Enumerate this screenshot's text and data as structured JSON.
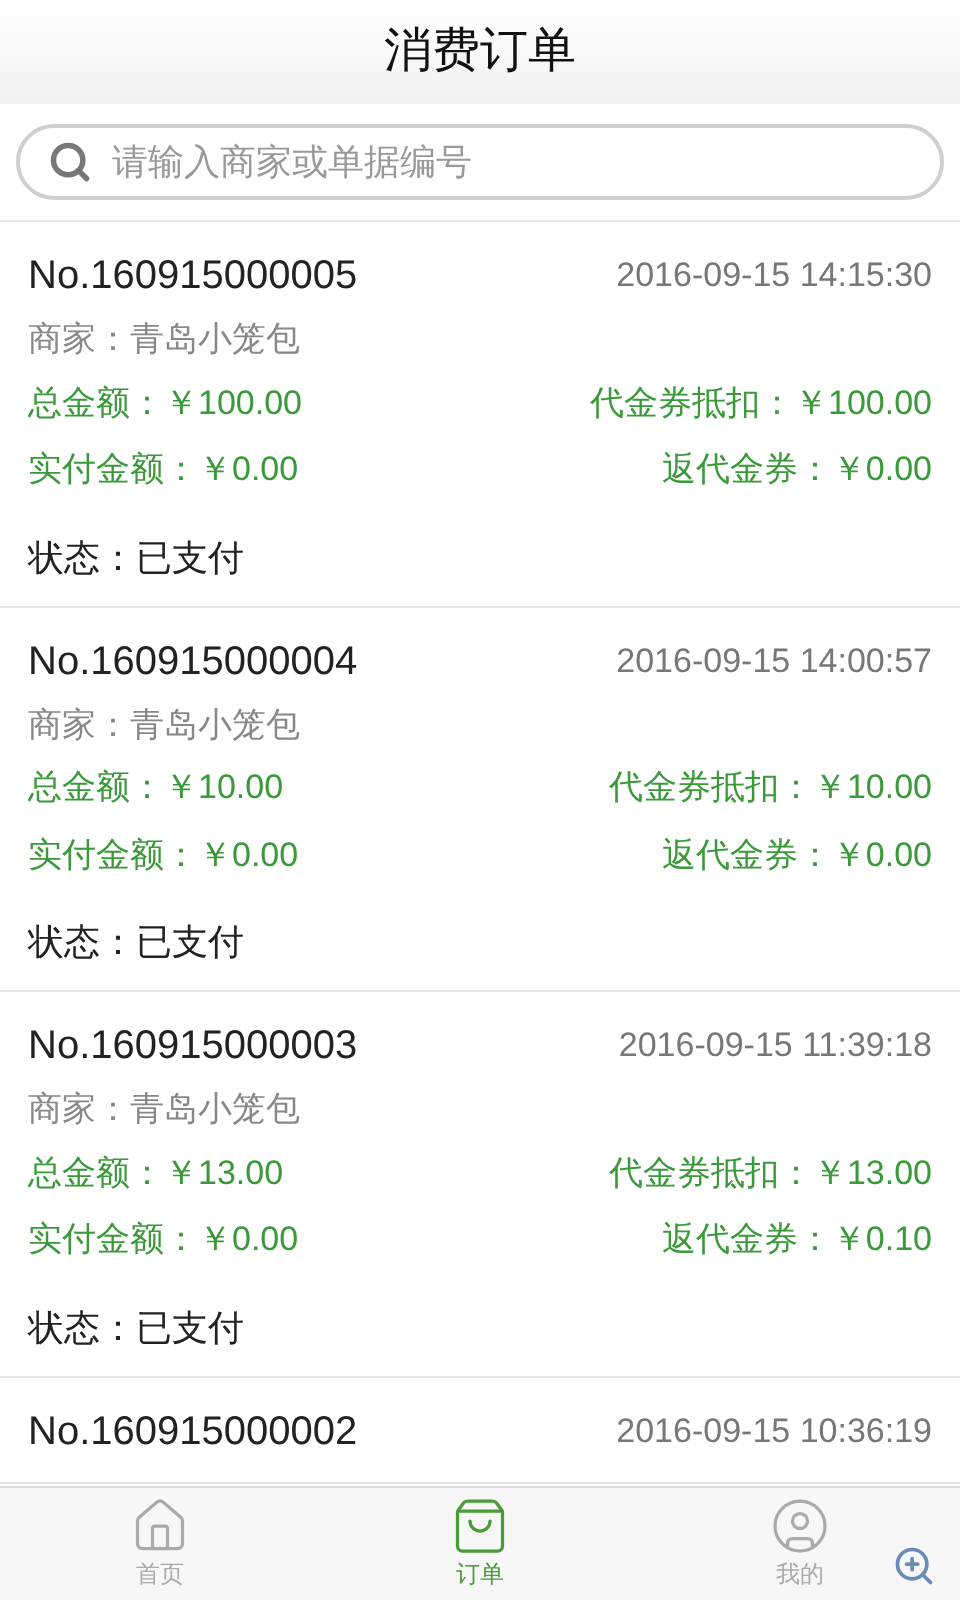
{
  "header": {
    "title": "消费订单"
  },
  "search": {
    "placeholder": "请输入商家或单据编号"
  },
  "orders": [
    {
      "number": "No.160915000005",
      "time": "2016-09-15 14:15:30",
      "merchant": "商家：青岛小笼包",
      "total": "总金额：￥100.00",
      "voucher_deduct": "代金券抵扣：￥100.00",
      "paid": "实付金额：￥0.00",
      "voucher_return": "返代金券：￥0.00",
      "status": "状态：已支付"
    },
    {
      "number": "No.160915000004",
      "time": "2016-09-15 14:00:57",
      "merchant": "商家：青岛小笼包",
      "total": "总金额：￥10.00",
      "voucher_deduct": "代金券抵扣：￥10.00",
      "paid": "实付金额：￥0.00",
      "voucher_return": "返代金券：￥0.00",
      "status": "状态：已支付"
    },
    {
      "number": "No.160915000003",
      "time": "2016-09-15 11:39:18",
      "merchant": "商家：青岛小笼包",
      "total": "总金额：￥13.00",
      "voucher_deduct": "代金券抵扣：￥13.00",
      "paid": "实付金额：￥0.00",
      "voucher_return": "返代金券：￥0.10",
      "status": "状态：已支付"
    },
    {
      "number": "No.160915000002",
      "time": "2016-09-15 10:36:19"
    }
  ],
  "tabs": [
    {
      "label": "首页",
      "kind": "home",
      "selected": false
    },
    {
      "label": "订单",
      "kind": "bag",
      "selected": true
    },
    {
      "label": "我的",
      "kind": "user",
      "selected": false
    }
  ]
}
